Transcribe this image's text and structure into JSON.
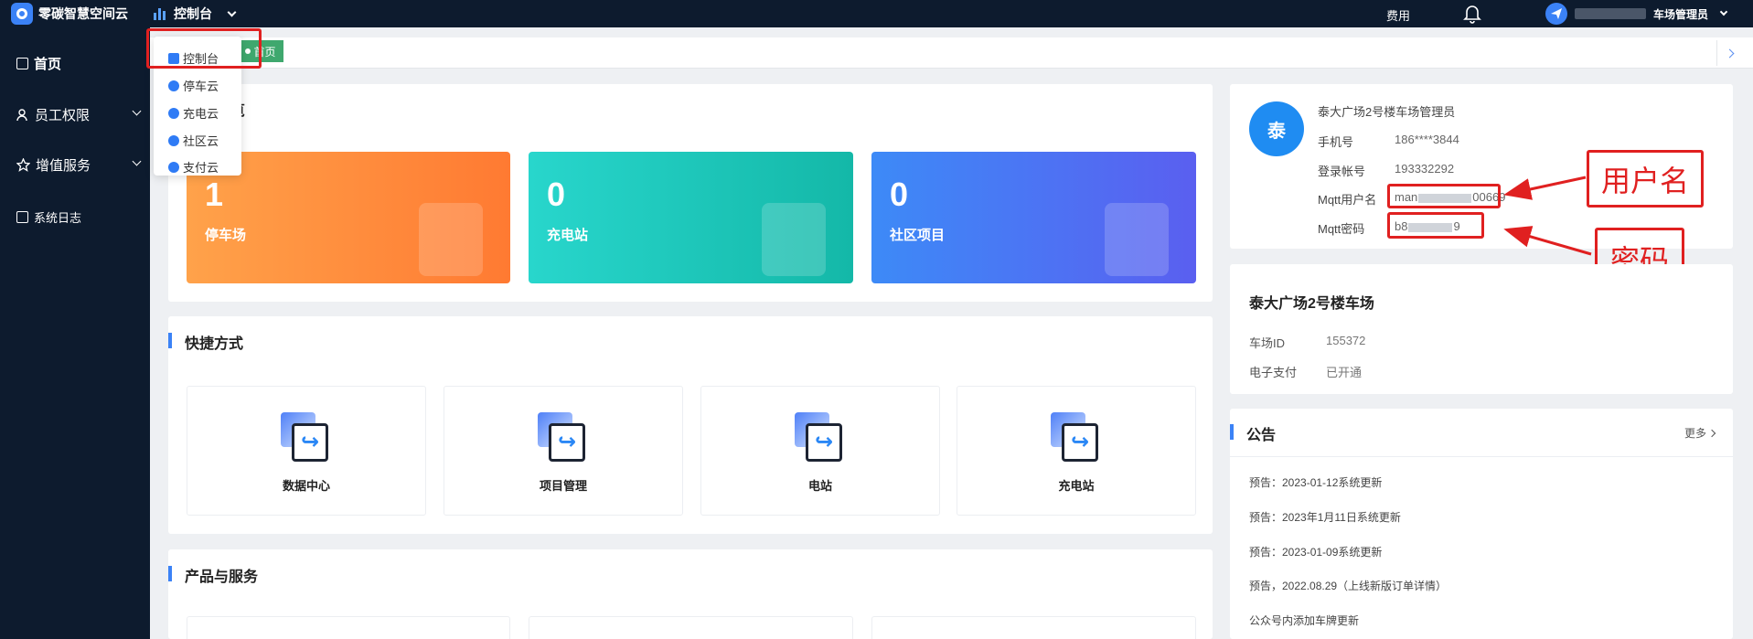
{
  "app": {
    "name": "零碳智慧空间云",
    "brand_color": "#3b82f6"
  },
  "topbar": {
    "console_label": "控制台",
    "fee_label": "费用",
    "user_role": "车场管理员"
  },
  "sidebar": {
    "items": [
      {
        "label": "首页",
        "icon": "page-icon"
      },
      {
        "label": "员工权限",
        "icon": "user-icon"
      },
      {
        "label": "增值服务",
        "icon": "star-icon"
      },
      {
        "label": "系统日志",
        "icon": "page-icon"
      }
    ]
  },
  "dropdown": {
    "items": [
      {
        "label": "控制台",
        "icon": "dashboard-icon"
      },
      {
        "label": "停车云",
        "icon": "parking-icon"
      },
      {
        "label": "充电云",
        "icon": "charging-icon"
      },
      {
        "label": "社区云",
        "icon": "community-icon"
      },
      {
        "label": "支付云",
        "icon": "payment-icon"
      }
    ]
  },
  "tabs": {
    "active": "首页"
  },
  "overview": {
    "title_fragment": "览",
    "stats": [
      {
        "value": "1",
        "label": "停车场",
        "color": "#ff8a3d"
      },
      {
        "value": "0",
        "label": "充电站",
        "color": "#1cc7bb"
      },
      {
        "value": "0",
        "label": "社区项目",
        "color": "#4a78f5"
      }
    ]
  },
  "shortcuts": {
    "title": "快捷方式",
    "items": [
      {
        "label": "数据中心"
      },
      {
        "label": "项目管理"
      },
      {
        "label": "电站"
      },
      {
        "label": "充电站"
      }
    ]
  },
  "products": {
    "title": "产品与服务"
  },
  "profile": {
    "avatar_char": "泰",
    "name": "泰大广场2号楼车场管理员",
    "phone_label": "手机号",
    "phone_value": "186****3844",
    "account_label": "登录帐号",
    "account_value": "193332292",
    "mqtt_user_label": "Mqtt用户名",
    "mqtt_user_value_start": "man",
    "mqtt_user_value_end": "00669",
    "mqtt_pwd_label": "Mqtt密码",
    "mqtt_pwd_value_start": "b8",
    "mqtt_pwd_value_end": "9"
  },
  "annotations": {
    "username": "用户名",
    "password": "密码",
    "color": "#e02020"
  },
  "parking_lot": {
    "title": "泰大广场2号楼车场",
    "id_label": "车场ID",
    "id_value": "155372",
    "pay_label": "电子支付",
    "pay_value": "已开通"
  },
  "notices": {
    "title": "公告",
    "more": "更多",
    "items": [
      "预告：2023-01-12系统更新",
      "预告：2023年1月11日系统更新",
      "预告：2023-01-09系统更新",
      "预告，2022.08.29（上线新版订单详情）",
      "公众号内添加车牌更新"
    ]
  }
}
